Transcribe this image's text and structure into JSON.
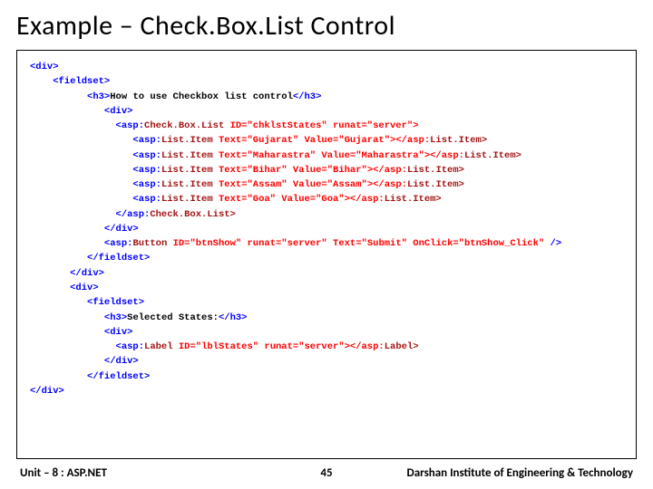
{
  "title": "Example – Check.Box.List Control",
  "code": {
    "l1": "<div>",
    "l2": "<fieldset>",
    "l3a": "<h3>",
    "l3b": "How to use Checkbox list control",
    "l3c": "</h3>",
    "l4": "<div>",
    "l5a": "<asp:",
    "l5b": "Check.Box.List",
    "l5c": "ID=\"chklstStates\"",
    "l5d": "runat=\"server\">",
    "li1a": "<asp:",
    "li1b": "List.Item",
    "li1c": "Text=\"Gujarat\"",
    "li1d": "Value=\"Gujarat\"></asp:",
    "li1e": "List.Item>",
    "li2a": "<asp:",
    "li2b": "List.Item",
    "li2c": "Text=\"Maharastra\"",
    "li2d": "Value=\"Maharastra\"></asp:",
    "li2e": "List.Item>",
    "li3a": "<asp:",
    "li3b": "List.Item",
    "li3c": "Text=\"Bihar\"",
    "li3d": "Value=\"Bihar\"></asp:",
    "li3e": "List.Item>",
    "li4a": "<asp:",
    "li4b": "List.Item",
    "li4c": "Text=\"Assam\"",
    "li4d": "Value=\"Assam\"></asp:",
    "li4e": "List.Item>",
    "li5a": "<asp:",
    "li5b": "List.Item",
    "li5c": "Text=\"Goa\"",
    "li5d": "Value=\"Goa\"></asp:",
    "li5e": "List.Item>",
    "l6a": "</asp:",
    "l6b": "Check.Box.List>",
    "l7": "</div>",
    "l8a": "<asp:",
    "l8b": "Button",
    "l8c": "ID=\"btnShow\"",
    "l8d": "runat=\"server\"",
    "l8e": "Text=\"Submit\"",
    "l8f": "OnClick=\"btnShow_Click\"",
    "l8g": "/>",
    "l9": "</fieldset>",
    "l10": "</div>",
    "l11": "<div>",
    "l12": "<fieldset>",
    "l13a": "<h3>",
    "l13b": "Selected States:",
    "l13c": "</h3>",
    "l14": "<div>",
    "l15a": "<asp:",
    "l15b": "Label",
    "l15c": "ID=\"lblStates\"",
    "l15d": "runat=\"server\"></asp:",
    "l15e": "Label>",
    "l16": "</div>",
    "l17": "</fieldset>",
    "l18": "</div>"
  },
  "footer": {
    "left": "Unit – 8 : ASP.NET",
    "center": "45",
    "right": "Darshan Institute of Engineering & Technology"
  }
}
